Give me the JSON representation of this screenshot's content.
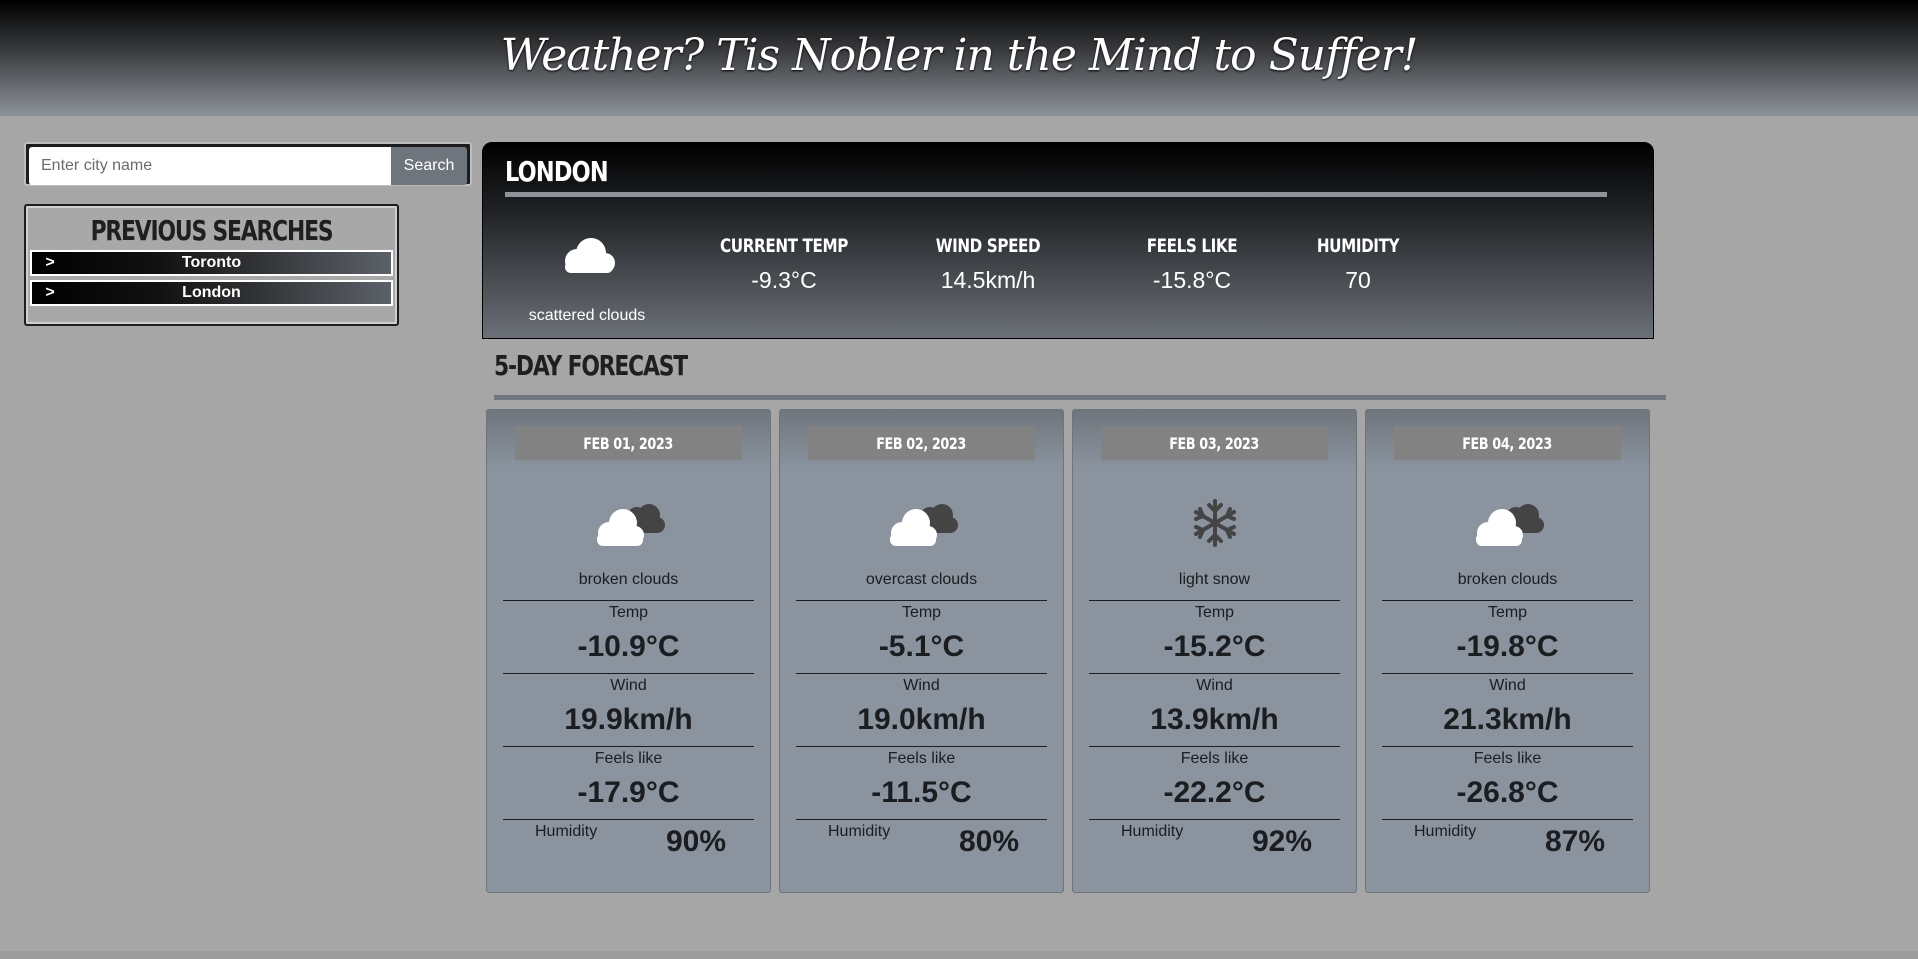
{
  "header": {
    "title": "Weather? Tis Nobler in the Mind to Suffer!"
  },
  "search": {
    "placeholder": "Enter city name",
    "value": "",
    "button_label": "Search"
  },
  "previous_searches": {
    "title": "PREVIOUS SEARCHES",
    "items": [
      {
        "arrow": ">",
        "label": "Toronto"
      },
      {
        "arrow": ">",
        "label": "London"
      }
    ]
  },
  "current": {
    "city": "LONDON",
    "icon": "cloud-icon",
    "description": "scattered clouds",
    "metrics": [
      {
        "label": "CURRENT TEMP",
        "value": "-9.3°C"
      },
      {
        "label": "WIND SPEED",
        "value": "14.5km/h"
      },
      {
        "label": "FEELS LIKE",
        "value": "-15.8°C"
      },
      {
        "label": "HUMIDITY",
        "value": "70"
      }
    ]
  },
  "forecast": {
    "title": "5-DAY FORECAST",
    "temp_label": "Temp",
    "wind_label": "Wind",
    "feels_label": "Feels like",
    "humidity_label": "Humidity",
    "days": [
      {
        "date": "FEB 01, 2023",
        "icon": "broken-clouds-icon",
        "description": "broken clouds",
        "temp": "-10.9°C",
        "wind": "19.9km/h",
        "feels": "-17.9°C",
        "humidity": "90%"
      },
      {
        "date": "FEB 02, 2023",
        "icon": "overcast-clouds-icon",
        "description": "overcast clouds",
        "temp": "-5.1°C",
        "wind": "19.0km/h",
        "feels": "-11.5°C",
        "humidity": "80%"
      },
      {
        "date": "FEB 03, 2023",
        "icon": "snowflake-icon",
        "description": "light snow",
        "temp": "-15.2°C",
        "wind": "13.9km/h",
        "feels": "-22.2°C",
        "humidity": "92%"
      },
      {
        "date": "FEB 04, 2023",
        "icon": "broken-clouds-icon",
        "description": "broken clouds",
        "temp": "-19.8°C",
        "wind": "21.3km/h",
        "feels": "-26.8°C",
        "humidity": "87%"
      }
    ]
  },
  "colors": {
    "header_top": "#000000",
    "header_bottom": "#8e939a",
    "page_bg": "#a6a6a6",
    "card_bg": "#8a939e",
    "date_chip": "#828282",
    "search_button": "#6e757d"
  }
}
